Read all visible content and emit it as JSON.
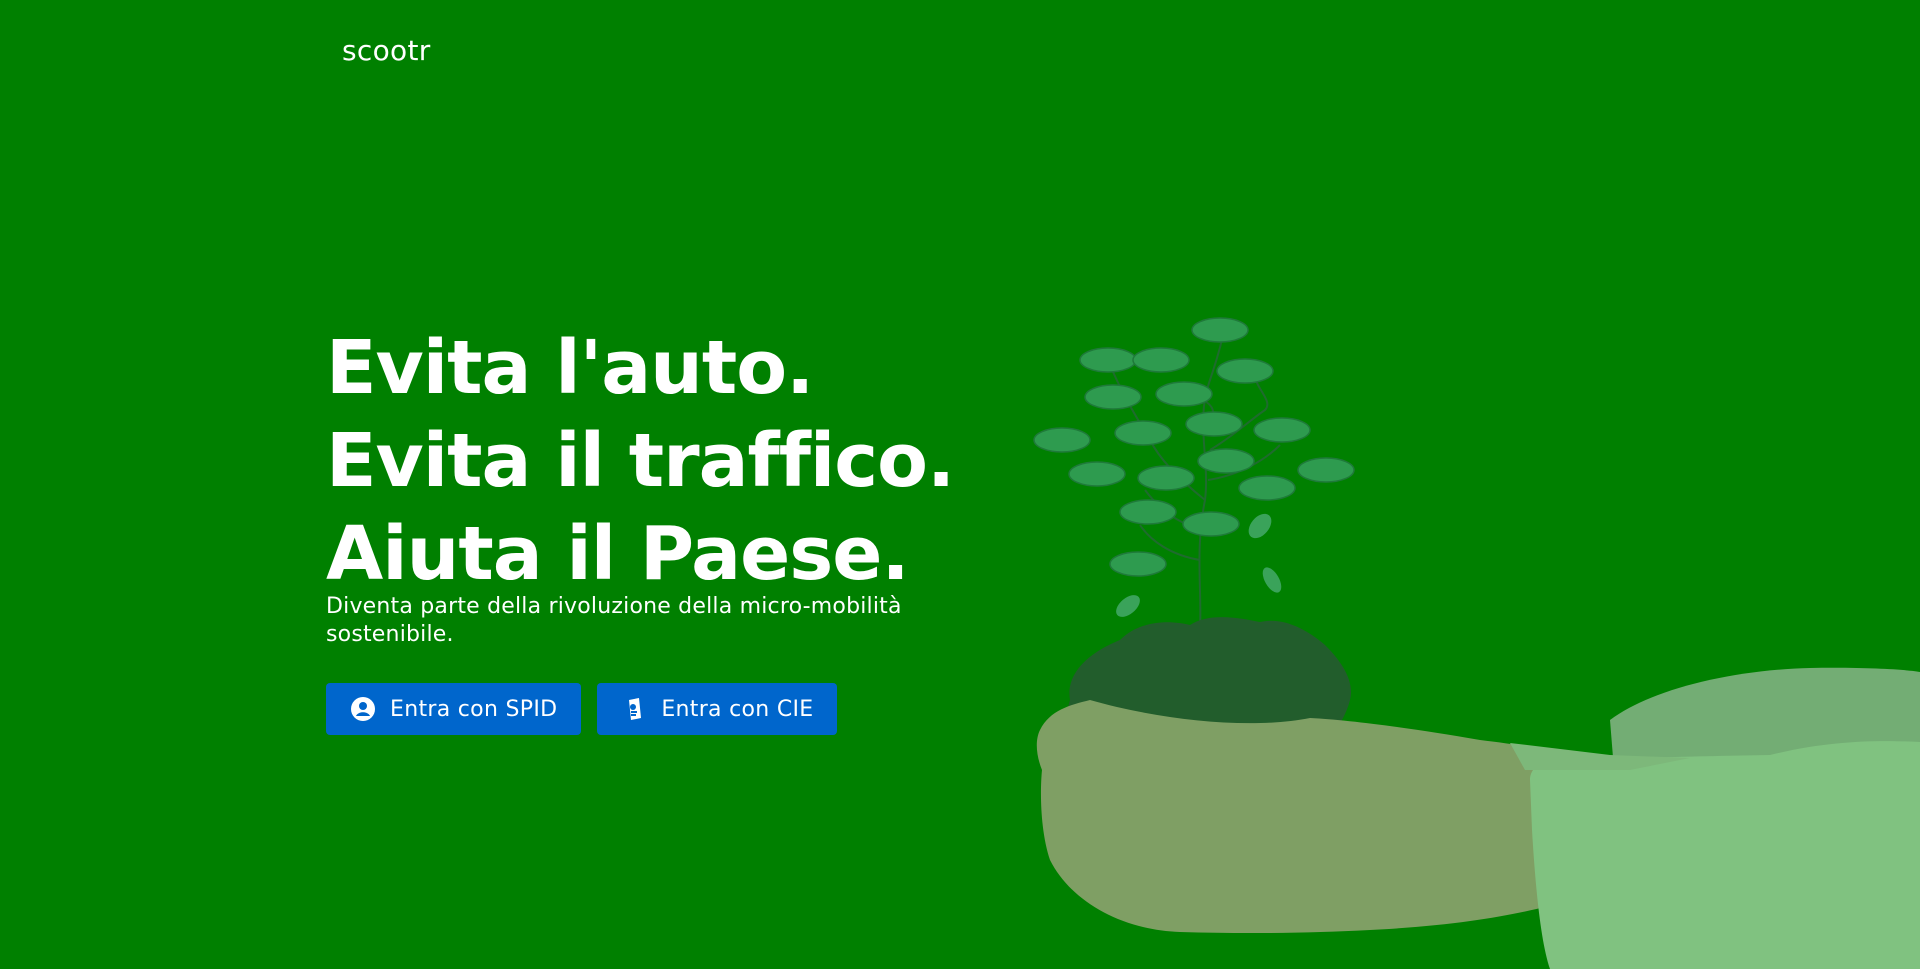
{
  "header": {
    "brand": "scootr"
  },
  "hero": {
    "headline_lines": [
      "Evita l'auto.",
      "Evita il traffico.",
      "Aiuta il Paese."
    ],
    "subtitle": "Diventa parte della rivoluzione della micro-mobilità sostenibile."
  },
  "actions": {
    "spid": {
      "label": "Entra con SPID",
      "icon": "user-circle-icon"
    },
    "cie": {
      "label": "Entra con CIE",
      "icon": "cie-card-icon"
    }
  },
  "colors": {
    "background": "#008000",
    "button": "#0066cc",
    "text": "#ffffff"
  }
}
